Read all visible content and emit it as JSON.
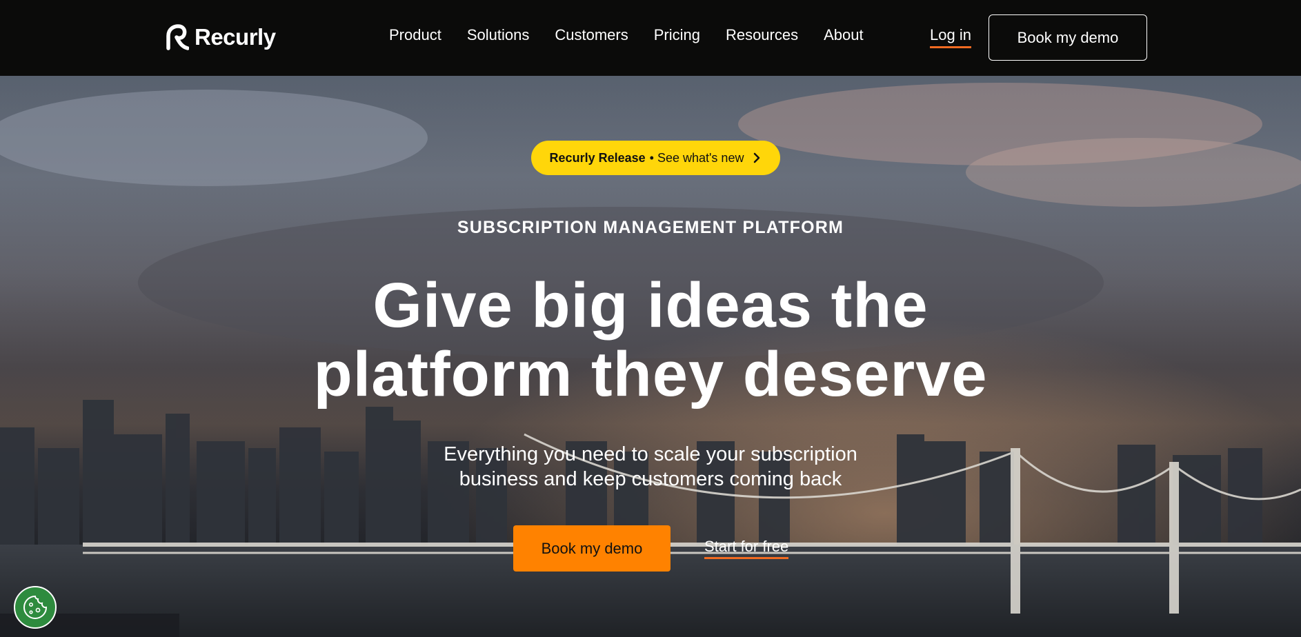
{
  "brand": {
    "name": "Recurly",
    "logo_icon": "recurly-r-icon"
  },
  "nav": {
    "items": [
      {
        "label": "Product"
      },
      {
        "label": "Solutions"
      },
      {
        "label": "Customers"
      },
      {
        "label": "Pricing"
      },
      {
        "label": "Resources"
      },
      {
        "label": "About"
      }
    ],
    "login_label": "Log in",
    "demo_label": "Book my demo"
  },
  "hero": {
    "release_strong": "Recurly Release",
    "release_rest": "• See what's new",
    "release_icon": "chevron-right-icon",
    "eyebrow": "SUBSCRIPTION MANAGEMENT PLATFORM",
    "headline_line1": "Give big ideas the",
    "headline_line2": "platform they deserve",
    "subhead_line1": "Everything you need to scale your subscription",
    "subhead_line2": "business and keep customers coming back",
    "primary_cta": "Book my demo",
    "secondary_cta": "Start for free",
    "background": "city-skyline-bridge-at-dusk"
  },
  "cookie": {
    "icon": "cookie-icon"
  },
  "colors": {
    "nav_bg": "#0b0b0a",
    "accent_orange": "#ff8200",
    "underline_orange": "#f26b21",
    "release_yellow": "#ffd60a",
    "cookie_green": "#2e8b3e"
  }
}
